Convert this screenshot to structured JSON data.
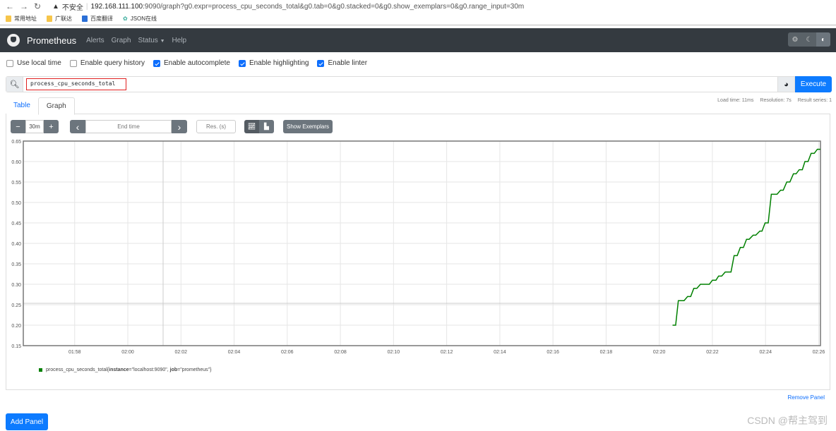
{
  "browser": {
    "insecure_label": "不安全",
    "url_host": "192.168.111.100",
    "url_rest": ":9090/graph?g0.expr=process_cpu_seconds_total&g0.tab=0&g0.stacked=0&g0.show_exemplars=0&g0.range_input=30m",
    "bookmarks": [
      "常用地址",
      "广联达",
      "百度翻译",
      "JSON在线"
    ]
  },
  "navbar": {
    "brand": "Prometheus",
    "links": [
      "Alerts",
      "Graph",
      "Status",
      "Help"
    ]
  },
  "options": [
    {
      "label": "Use local time",
      "checked": false
    },
    {
      "label": "Enable query history",
      "checked": false
    },
    {
      "label": "Enable autocomplete",
      "checked": true
    },
    {
      "label": "Enable highlighting",
      "checked": true
    },
    {
      "label": "Enable linter",
      "checked": true
    }
  ],
  "query": {
    "value": "process_cpu_seconds_total",
    "execute_label": "Execute"
  },
  "tabs": [
    {
      "label": "Table",
      "active": false
    },
    {
      "label": "Graph",
      "active": true
    }
  ],
  "meta": {
    "load_time": "Load time: 11ms",
    "resolution": "Resolution: 7s",
    "result_series": "Result series: 1"
  },
  "controls": {
    "range": "30m",
    "end_time_placeholder": "End time",
    "res_placeholder": "Res. (s)",
    "show_exemplars": "Show Exemplars",
    "minus": "−",
    "plus": "+",
    "prev": "‹",
    "next": "›"
  },
  "chart_data": {
    "type": "line",
    "x_range": [
      "01:56:04",
      "02:26:04"
    ],
    "ylim": [
      0.15,
      0.65
    ],
    "yticks": [
      "0.15",
      "0.20",
      "0.25",
      "0.30",
      "0.35",
      "0.40",
      "0.45",
      "0.50",
      "0.55",
      "0.60",
      "0.65"
    ],
    "xticks": [
      "01:58",
      "02:00",
      "02:02",
      "02:04",
      "02:06",
      "02:08",
      "02:10",
      "02:12",
      "02:14",
      "02:16",
      "02:18",
      "02:20",
      "02:22",
      "02:24",
      "02:26"
    ],
    "grid": true,
    "series": [
      {
        "name": "process_cpu_seconds_total{instance=\"localhost:9090\", job=\"prometheus\"}",
        "color": "#008000",
        "points": [
          [
            "02:20:30",
            0.2
          ],
          [
            "02:20:37",
            0.2
          ],
          [
            "02:20:43",
            0.26
          ],
          [
            "02:20:56",
            0.26
          ],
          [
            "02:21:04",
            0.27
          ],
          [
            "02:21:11",
            0.27
          ],
          [
            "02:21:18",
            0.29
          ],
          [
            "02:21:25",
            0.29
          ],
          [
            "02:21:33",
            0.3
          ],
          [
            "02:21:53",
            0.3
          ],
          [
            "02:22:00",
            0.31
          ],
          [
            "02:22:08",
            0.31
          ],
          [
            "02:22:14",
            0.32
          ],
          [
            "02:22:21",
            0.32
          ],
          [
            "02:22:29",
            0.33
          ],
          [
            "02:22:42",
            0.33
          ],
          [
            "02:22:49",
            0.37
          ],
          [
            "02:22:56",
            0.37
          ],
          [
            "02:23:03",
            0.39
          ],
          [
            "02:23:10",
            0.39
          ],
          [
            "02:23:17",
            0.41
          ],
          [
            "02:23:23",
            0.41
          ],
          [
            "02:23:32",
            0.42
          ],
          [
            "02:23:38",
            0.42
          ],
          [
            "02:23:47",
            0.43
          ],
          [
            "02:23:52",
            0.43
          ],
          [
            "02:23:59",
            0.45
          ],
          [
            "02:24:06",
            0.45
          ],
          [
            "02:24:13",
            0.52
          ],
          [
            "02:24:26",
            0.52
          ],
          [
            "02:24:34",
            0.53
          ],
          [
            "02:24:40",
            0.53
          ],
          [
            "02:24:48",
            0.55
          ],
          [
            "02:24:55",
            0.55
          ],
          [
            "02:25:03",
            0.57
          ],
          [
            "02:25:09",
            0.57
          ],
          [
            "02:25:16",
            0.58
          ],
          [
            "02:25:23",
            0.58
          ],
          [
            "02:25:29",
            0.6
          ],
          [
            "02:25:36",
            0.6
          ],
          [
            "02:25:43",
            0.62
          ],
          [
            "02:25:50",
            0.62
          ],
          [
            "02:25:57",
            0.63
          ],
          [
            "02:26:04",
            0.63
          ]
        ]
      }
    ]
  },
  "legend": {
    "metric": "process_cpu_seconds_total",
    "open": "{",
    "k1": "instance",
    "v1": "=\"localhost:9090\", ",
    "k2": "job",
    "v2": "=\"prometheus\"}"
  },
  "remove_panel": "Remove Panel",
  "add_panel": "Add Panel",
  "watermark": "CSDN @帮主驾到"
}
